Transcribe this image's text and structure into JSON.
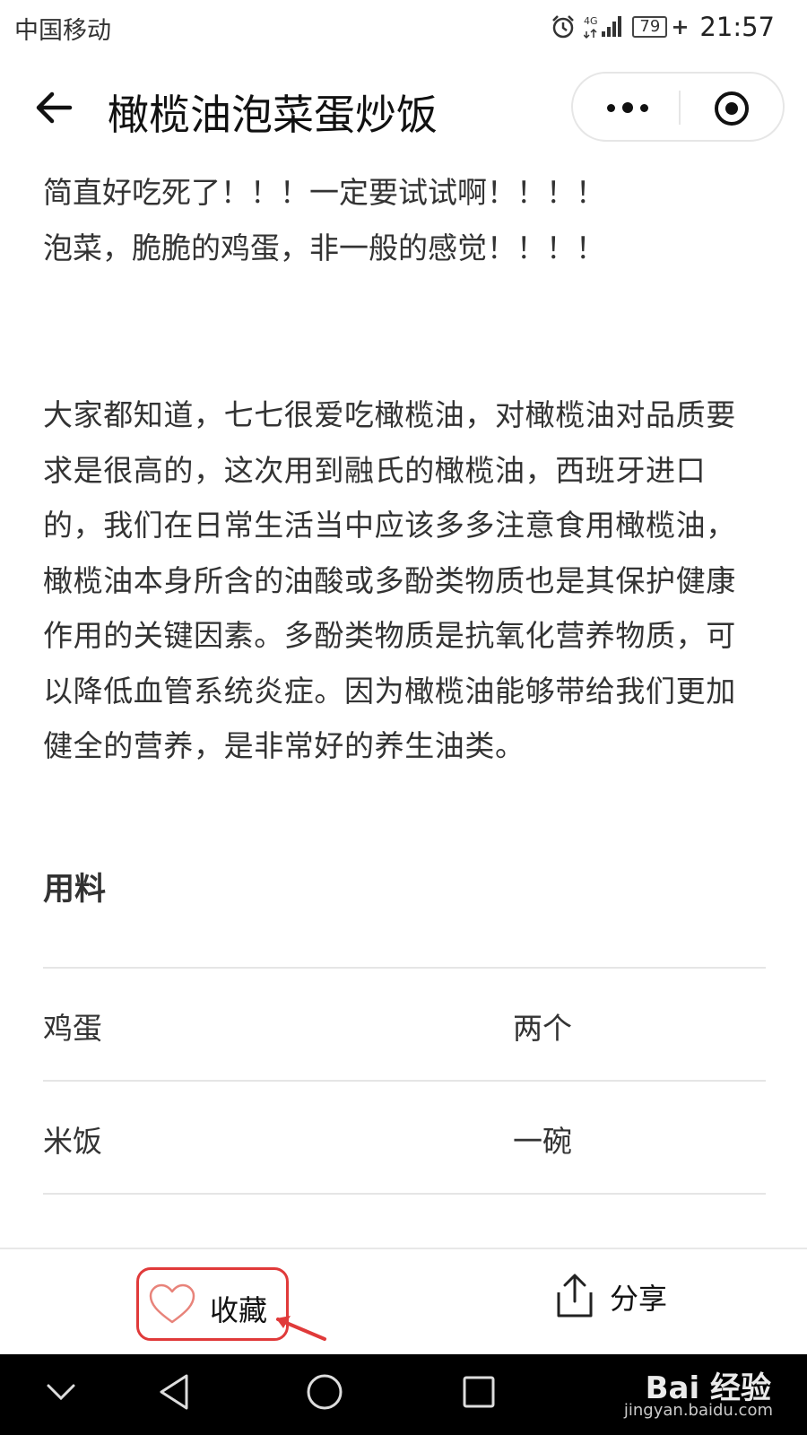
{
  "status_bar": {
    "carrier": "中国移动",
    "network": "4G",
    "battery": "79",
    "time": "21:57"
  },
  "nav": {
    "title": "橄榄油泡菜蛋炒饭"
  },
  "content": {
    "intro_lines": [
      "简直好吃死了！！！一定要试试啊！！！！",
      "泡菜，脆脆的鸡蛋，非一般的感觉！！！！"
    ],
    "body_lines": [
      "大家都知道，七七很爱吃橄榄油，对橄榄油对品质要",
      "求是很高的，这次用到融氏的橄榄油，西班牙进口",
      "的，我们在日常生活当中应该多多注意食用橄榄油，",
      "橄榄油本身所含的油酸或多酚类物质也是其保护健康",
      "作用的关键因素。多酚类物质是抗氧化营养物质，可",
      "以降低血管系统炎症。因为橄榄油能够带给我们更加",
      "健全的营养，是非常好的养生油类。"
    ],
    "ingredients_title": "用料",
    "ingredients": [
      {
        "name": "鸡蛋",
        "qty": "两个"
      },
      {
        "name": "米饭",
        "qty": "一碗"
      }
    ]
  },
  "action_bar": {
    "favorite_label": "收藏",
    "share_label": "分享"
  },
  "watermark": {
    "text": "Bai 经验",
    "url": "jingyan.baidu.com"
  },
  "colors": {
    "highlight_red": "#e03a3a",
    "text": "#333333",
    "divider": "#e5e5e5"
  }
}
